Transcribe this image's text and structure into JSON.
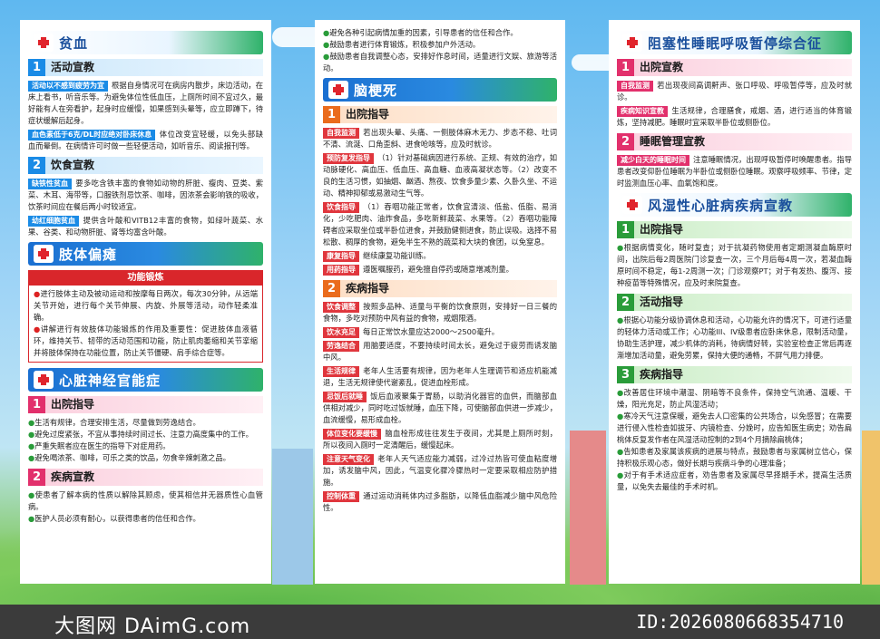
{
  "panel1": {
    "anemia": {
      "title": "贫血",
      "s1": {
        "num": "1",
        "label": "活动宣教"
      },
      "s1_items": [
        {
          "tag": "活动以不感到疲劳为宜",
          "text": "根据自身情况可在病房内散步，床边活动，在床上看书，听音乐等。为避免体位性低血压，上厕所时间不宜过久，最好能有人在旁看护，起身时应缓慢，如果感到头晕等，应立即蹲下，待症状缓解后起身。"
        },
        {
          "tag": "血色素低于6克/DL时应绝对卧床休息",
          "text": "体位改变宜轻缓，以免头部缺血而晕倒。在病情许可时做一些轻便活动，如听音乐、阅读报刊等。"
        }
      ],
      "s2": {
        "num": "2",
        "label": "饮食宣教"
      },
      "s2_items": [
        {
          "tag": "缺铁性贫血",
          "text": "要多吃含铁丰富的食物如动物的肝脏、瘦肉、豆类、紫菜、木耳、海带等，口服铁剂忌饮茶、咖啡，因浓茶会影响铁的吸收，饮茶时间应在餐后两小时较适宜。"
        },
        {
          "tag": "幼红细胞贫血",
          "text": "提供含叶酸和VITB12丰富的食物，如绿叶蔬菜、水果、谷类、和动物肝脏、肾等均富含叶酸。"
        }
      ]
    },
    "paralysis": {
      "title": "肢体偏瘫",
      "box_title": "功能锻炼",
      "items": [
        "进行肢体主动及被动运动和按摩每日两次，每次30分钟，从远端关节开始，进行每个关节伸展、内旋、外展等活动，动作轻柔准确。",
        "讲解进行有效肢体功能锻炼的作用及重要性：促进肢体血液循环，维持关节、韧带的活动范围和功能，防止肌肉萎缩和关节挛缩并将肢体保持在功能位置，防止关节僵硬、肩手综合症等。"
      ]
    },
    "cardioneurosis": {
      "title": "心脏神经官能症",
      "s1": {
        "num": "1",
        "label": "出院指导"
      },
      "s1_items": [
        "生活有规律，合理安排生活，尽量做到劳逸结合。",
        "避免过度紧张，不宜从事持续时间过长、注意力高度集中的工作。",
        "严重失眠者应在医生的指导下对症用药。",
        "避免喝浓茶、咖啡，可乐之类的饮品，勿食辛辣刺激之品。"
      ],
      "s2": {
        "num": "2",
        "label": "疾病宣教"
      },
      "s2_items": [
        "使患者了解本病的性质以解除其顾虑，使其相信并无器质性心血管病。",
        "医护人员必须有耐心，以获得患者的信任和合作。"
      ]
    }
  },
  "panel2": {
    "top_items": [
      "避免各种引起病情加重的因素，引导患者的信任和合作。",
      "鼓励患者进行体育锻炼，积极参加户外活动。",
      "鼓励患者自我调整心态，安排好作息时间，适量进行文娱、旅游等活动。"
    ],
    "infarction": {
      "title": "脑梗死",
      "s1": {
        "num": "1",
        "label": "出院指导"
      },
      "s1_items": [
        {
          "tag": "自我监测",
          "text": "若出现头晕、头痛、一侧肢体麻木无力、步态不稳、吐词不清、流涎、口角歪斜、进食呛咳等，应及时就诊。"
        },
        {
          "tag": "预防复发指导",
          "text": "（1）针对基础病因进行系统、正规、有效的治疗，如动脉硬化、高血压、低血压、高血糖、血液高凝状态等。（2）改变不良的生活习惯，如抽烟、酗酒、熬夜、饮食多量少素、久卧久坐、不运动、精神抑郁或易激动生气等。"
        },
        {
          "tag": "饮食指导",
          "text": "（1）吞咽功能正常者，饮食宜清淡、低盐、低脂、易消化，少吃肥肉、油炸食品，多吃新鲜蔬菜、水果等。（2）吞咽功能障碍者应采取坐位或半卧位进食，并鼓励健侧进食，防止误吸。选择不易松散、稠厚的食物，避免半生不熟的蔬菜和大块的食团，以免窒息。"
        },
        {
          "tag": "康复指导",
          "text": "继续康复功能训练。"
        },
        {
          "tag": "用药指导",
          "text": "遵医嘱服药，避免擅自停药或随意增减剂量。"
        }
      ],
      "s2": {
        "num": "2",
        "label": "疾病指导"
      },
      "s2_items": [
        {
          "tag": "饮食调整",
          "text": "按照多品种、适量与平衡的饮食原则，安排好一日三餐的食物，多吃对预防中风有益的食物，戒烟限酒。"
        },
        {
          "tag": "饮水充足",
          "text": "每日正常饮水量应达2000～2500毫升。"
        },
        {
          "tag": "劳逸结合",
          "text": "用脑要适度，不要持续时间太长，避免过于疲劳而诱发脑中风。"
        },
        {
          "tag": "生活规律",
          "text": "老年人生活要有规律，因为老年人生理调节和适应机能减退，生活无规律使代谢紊乱，促进血栓形成。"
        },
        {
          "tag": "忌饭后就睡",
          "text": "饭后血液聚集于胃肠，以助消化器官的血供，而脑部血供相对减少，同时吃过饭就睡，血压下降，可使脑部血供进一步减少，血流缓慢，易形成血栓。"
        },
        {
          "tag": "体位变化要缓慢",
          "text": "脑血栓形成往往发生于夜间，尤其是上厕所时刻，所以夜间入厕时一定清醒后，缓慢起床。"
        },
        {
          "tag": "注意天气变化",
          "text": "老年人天气适应能力减弱，过冷过热皆可使血粘度增加，诱发脑中风，因此，气温变化骤冷骤热时一定要采取相应防护措施。"
        },
        {
          "tag": "控制体重",
          "text": "通过运动消耗体内过多脂肪，以降低血脂减少脑中风危险性。"
        }
      ]
    }
  },
  "panel3": {
    "apnea": {
      "title": "阻塞性睡眠呼吸暂停综合征",
      "s1": {
        "num": "1",
        "label": "出院宣教"
      },
      "s1_items": [
        {
          "tag": "自我监测",
          "text": "若出现夜间高调鼾声、张口呼吸、呼吸暂停等，应及时就诊。"
        },
        {
          "tag": "疾病知识宣教",
          "text": "生活规律，合理膳食，戒烟、酒，进行适当的体育锻炼，坚持减肥。睡眠时宜采取半卧位或侧卧位。"
        }
      ],
      "s2": {
        "num": "2",
        "label": "睡眠管理宣教"
      },
      "s2_items": [
        {
          "tag": "减少白天的睡眠时间",
          "text": "注意睡眠情况，出现呼吸暂停时唤醒患者。指导患者改变仰卧位睡眠为半卧位或侧卧位睡眠。观察呼吸频率、节律，定时监测血压心率、血氧饱和度。"
        }
      ]
    },
    "rheumatic": {
      "title": "风湿性心脏病疾病宣教",
      "s1": {
        "num": "1",
        "label": "出院指导"
      },
      "s1_items": [
        "根据病情变化，随时复查；对于抗凝药物使用者定期测凝血酶原时间，出院后每2周医院门诊复查一次，三个月后每4周一次，若凝血酶原时间不稳定，每1-2周测一次；门诊观察PT；对于有发热、腹泻、接种疫苗等特殊情况，应及时来院复查。"
      ],
      "s2": {
        "num": "2",
        "label": "活动指导"
      },
      "s2_items": [
        "根据心功能分级协调休息和活动，心功能允许的情况下，可进行适量的轻体力活动或工作；心功能III、IV级患者应卧床休息，限制活动量，协助生活护理，减少机体的消耗，待病情好转，实验室检查正常后再逐渐增加活动量，避免劳累，保持大便的通畅，不屏气用力排便。"
      ],
      "s3": {
        "num": "3",
        "label": "疾病指导"
      },
      "s3_items": [
        "改善居住环境中潮湿、阴暗等不良条件，保持空气流通、温暖、干燥，阳光充足，防止风湿活动；",
        "寒冷天气注意保暖，避免去人口密集的公共场合，以免感冒；在需要进行侵入性检查如拔牙、内镜检查、分娩时，应告知医生病史；劝告扁桃体反复发作者在风湿活动控制的2到4个月摘除扁桃体；",
        "告知患者及家属该疾病的进展与特点，鼓励患者与家属树立信心，保持积极乐观心态，做好长期与疾病斗争的心理准备；",
        "对于有手术适应症者，劝告患者及家属尽早择期手术，提高生活质量，以免失去最佳的手术时机。"
      ]
    }
  },
  "footer": {
    "left": "大图网 DAimG.com",
    "right": "ID:2026080668354710"
  }
}
